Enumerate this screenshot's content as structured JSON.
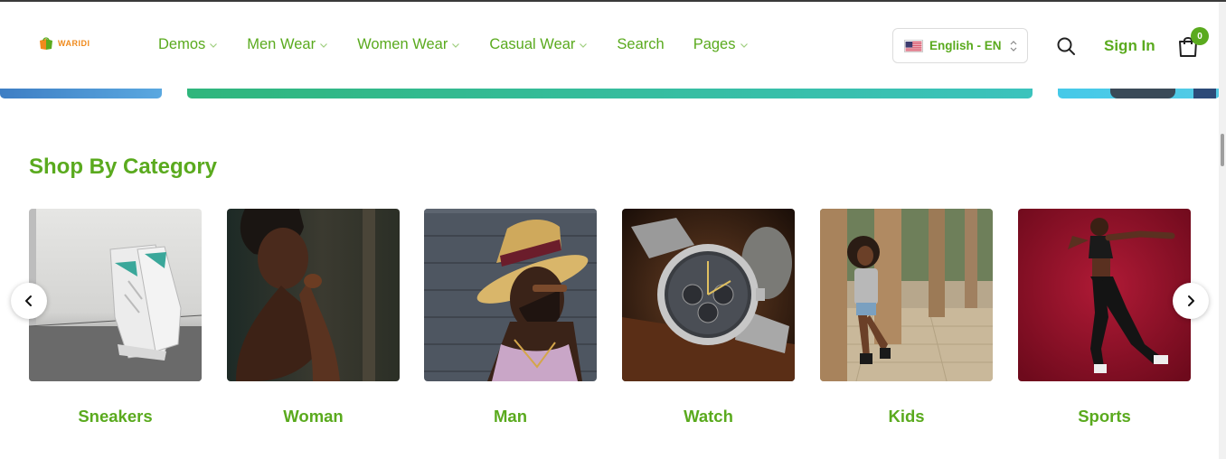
{
  "brand": {
    "logo_text": "WARIDI"
  },
  "nav": {
    "items": [
      {
        "label": "Demos",
        "has_dropdown": true
      },
      {
        "label": "Men Wear",
        "has_dropdown": true
      },
      {
        "label": "Women Wear",
        "has_dropdown": true
      },
      {
        "label": "Casual Wear",
        "has_dropdown": true
      },
      {
        "label": "Search",
        "has_dropdown": false
      },
      {
        "label": "Pages",
        "has_dropdown": true
      }
    ]
  },
  "language": {
    "selected": "English - EN",
    "icon": "us-flag-icon"
  },
  "account": {
    "signin_label": "Sign In"
  },
  "cart": {
    "count": "0",
    "icon": "shopping-bag-icon"
  },
  "section": {
    "title": "Shop By Category"
  },
  "categories": [
    {
      "label": "Sneakers",
      "image": "white-sneakers-photo"
    },
    {
      "label": "Woman",
      "image": "woman-portrait-photo"
    },
    {
      "label": "Man",
      "image": "man-straw-hat-photo"
    },
    {
      "label": "Watch",
      "image": "silver-chronograph-watch-photo"
    },
    {
      "label": "Kids",
      "image": "girl-posing-photo"
    },
    {
      "label": "Sports",
      "image": "athlete-jumping-photo"
    }
  ],
  "carousel": {
    "prev_icon": "chevron-left-icon",
    "next_icon": "chevron-right-icon"
  },
  "colors": {
    "accent": "#5aaa1e",
    "logo": "#f08a1c"
  }
}
